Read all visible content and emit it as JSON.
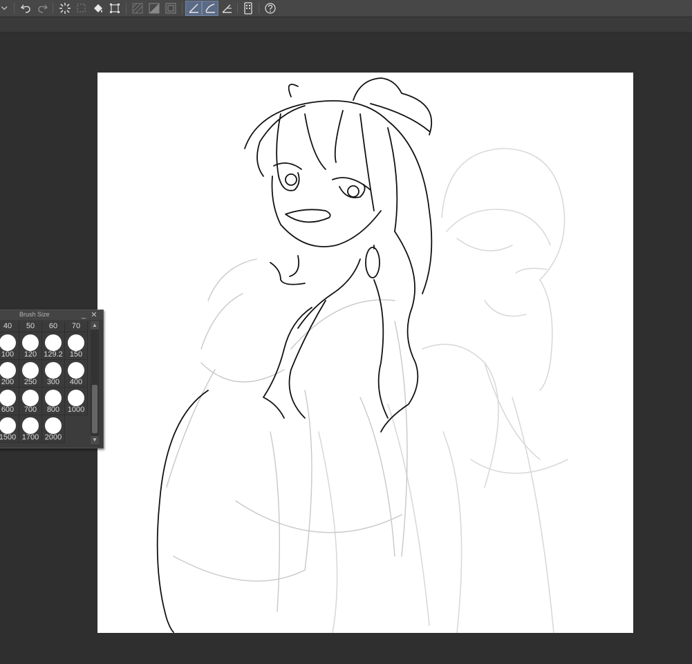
{
  "toolbar": {
    "buttons": [
      {
        "name": "dropdown-chevron-icon"
      },
      {
        "name": "undo-icon"
      },
      {
        "name": "redo-icon"
      },
      {
        "name": "loading-spinner-icon"
      },
      {
        "name": "clear-selection-icon"
      },
      {
        "name": "fill-bucket-icon"
      },
      {
        "name": "transform-icon"
      },
      {
        "name": "hatch-icon"
      },
      {
        "name": "invert-selection-icon"
      },
      {
        "name": "frame-icon"
      },
      {
        "name": "ruler-snap-icon"
      },
      {
        "name": "special-ruler-snap-icon"
      },
      {
        "name": "grid-snap-icon"
      },
      {
        "name": "device-icon"
      },
      {
        "name": "help-icon"
      }
    ]
  },
  "brush_panel": {
    "title": "Brush Size",
    "minimize_label": "_",
    "close_label": "✕",
    "top_row": [
      "40",
      "50",
      "60",
      "70"
    ],
    "rows": [
      [
        "100",
        "120",
        "129.2",
        "150"
      ],
      [
        "200",
        "250",
        "300",
        "400"
      ],
      [
        "600",
        "700",
        "800",
        "1000"
      ],
      [
        "1500",
        "1700",
        "2000"
      ]
    ],
    "scroll_up": "▲",
    "scroll_down": "▼"
  },
  "colors": {
    "background": "#2f2f2f",
    "toolbar": "#474747",
    "active_button": "#5b6a85",
    "canvas": "#ffffff"
  }
}
